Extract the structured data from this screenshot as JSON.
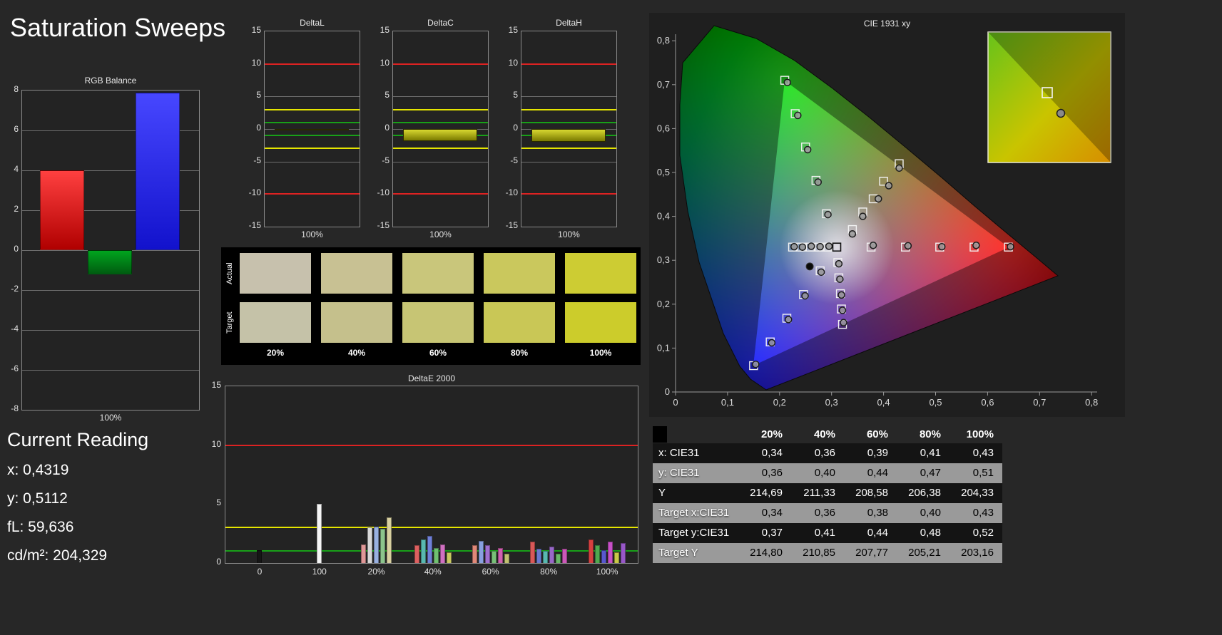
{
  "page": {
    "title": "Saturation Sweeps"
  },
  "colors": {
    "ref_red": "#dd2222",
    "ref_yellow": "#e6e600",
    "ref_green": "#18a018",
    "grid": "#6e6e6e"
  },
  "rgb_balance": {
    "title": "RGB Balance",
    "x_label": "100%",
    "type": "bar",
    "ylim": [
      -8,
      8
    ],
    "yticks": [
      8,
      6,
      4,
      2,
      0,
      -2,
      -4,
      -6,
      -8
    ],
    "bars": [
      {
        "name": "red",
        "value": 4.0,
        "color1": "#ff4040",
        "color2": "#b00000"
      },
      {
        "name": "green",
        "value": -1.2,
        "color1": "#00a41e",
        "color2": "#005c10"
      },
      {
        "name": "blue",
        "value": 7.9,
        "color1": "#4747ff",
        "color2": "#1212cc"
      }
    ]
  },
  "delta_charts": {
    "type": "bar",
    "ylim": [
      -15,
      15
    ],
    "yticks": [
      15,
      10,
      5,
      0,
      -5,
      -10,
      -15
    ],
    "gridlines": [
      5,
      0,
      -5
    ],
    "ref_lines": [
      {
        "v": 10,
        "color": "#dd2222"
      },
      {
        "v": 3,
        "color": "#e6e600"
      },
      {
        "v": 1,
        "color": "#18a018"
      },
      {
        "v": -1,
        "color": "#18a018"
      },
      {
        "v": -3,
        "color": "#e6e600"
      },
      {
        "v": -10,
        "color": "#dd2222"
      }
    ],
    "x_label": "100%",
    "bar_color1": "#d8d830",
    "bar_color2": "#7a7a00",
    "charts": [
      {
        "title": "DeltaL",
        "value": -0.2
      },
      {
        "title": "DeltaC",
        "value": -1.9
      },
      {
        "title": "DeltaH",
        "value": -2.0
      }
    ]
  },
  "swatches": {
    "row_labels": [
      "Actual",
      "Target"
    ],
    "percent_labels": [
      "20%",
      "40%",
      "60%",
      "80%",
      "100%"
    ],
    "actual": [
      "#c7c1ad",
      "#c8c193",
      "#c9c67b",
      "#cac85d",
      "#cdcc33"
    ],
    "target": [
      "#c5c2a8",
      "#c5c08c",
      "#c7c574",
      "#c9c756",
      "#cccc2b"
    ]
  },
  "deltae": {
    "title": "DeltaE 2000",
    "type": "bar",
    "ylim": [
      0,
      15
    ],
    "yticks": [
      0,
      5,
      10,
      15
    ],
    "ref_lines": [
      {
        "v": 10,
        "color": "#dd2222"
      },
      {
        "v": 3,
        "color": "#e6e600"
      },
      {
        "v": 1,
        "color": "#18a018"
      }
    ],
    "groups": [
      {
        "label": "0",
        "x": 0.083,
        "bars": [
          {
            "color": "#161616",
            "value": 1.1
          }
        ]
      },
      {
        "label": "100",
        "x": 0.228,
        "bars": [
          {
            "color": "#f5f5f5",
            "value": 5.0
          }
        ]
      },
      {
        "label": "20%",
        "x": 0.366,
        "bars": [
          {
            "color": "#e09898",
            "value": 1.6
          },
          {
            "color": "#d8d8d8",
            "value": 3.0
          },
          {
            "color": "#98b0e0",
            "value": 3.1
          },
          {
            "color": "#8cc48c",
            "value": 2.9
          },
          {
            "color": "#d8d0a0",
            "value": 3.9
          }
        ]
      },
      {
        "label": "40%",
        "x": 0.503,
        "bars": [
          {
            "color": "#dd6060",
            "value": 1.5
          },
          {
            "color": "#58b8b0",
            "value": 2.0
          },
          {
            "color": "#7080d8",
            "value": 2.3
          },
          {
            "color": "#70c070",
            "value": 1.3
          },
          {
            "color": "#d070c0",
            "value": 1.6
          },
          {
            "color": "#c8c860",
            "value": 0.9
          }
        ]
      },
      {
        "label": "60%",
        "x": 0.643,
        "bars": [
          {
            "color": "#e08878",
            "value": 1.5
          },
          {
            "color": "#88a0e0",
            "value": 1.9
          },
          {
            "color": "#a070d0",
            "value": 1.5
          },
          {
            "color": "#78c078",
            "value": 1.0
          },
          {
            "color": "#d060b0",
            "value": 1.3
          },
          {
            "color": "#c0c070",
            "value": 0.8
          }
        ]
      },
      {
        "label": "80%",
        "x": 0.784,
        "bars": [
          {
            "color": "#d85858",
            "value": 1.8
          },
          {
            "color": "#6878d0",
            "value": 1.2
          },
          {
            "color": "#58b8b0",
            "value": 1.0
          },
          {
            "color": "#9868c8",
            "value": 1.4
          },
          {
            "color": "#68b868",
            "value": 0.8
          },
          {
            "color": "#cc58b8",
            "value": 1.2
          }
        ]
      },
      {
        "label": "100%",
        "x": 0.926,
        "bars": [
          {
            "color": "#d84040",
            "value": 2.0
          },
          {
            "color": "#50a850",
            "value": 1.5
          },
          {
            "color": "#5858d0",
            "value": 1.1
          },
          {
            "color": "#c850c8",
            "value": 1.8
          },
          {
            "color": "#c8c848",
            "value": 0.9
          },
          {
            "color": "#9858c8",
            "value": 1.7
          }
        ]
      }
    ]
  },
  "cie": {
    "title": "CIE 1931 xy",
    "type": "scatter",
    "xlim": [
      0,
      0.8
    ],
    "ylim": [
      0,
      0.8
    ],
    "xticks": [
      "0",
      "0,1",
      "0,2",
      "0,3",
      "0,4",
      "0,5",
      "0,6",
      "0,7",
      "0,8"
    ],
    "yticks": [
      "0",
      "0,1",
      "0,2",
      "0,3",
      "0,4",
      "0,5",
      "0,6",
      "0,7",
      "0,8"
    ],
    "gamut_triangle": {
      "red": [
        0.64,
        0.33
      ],
      "green": [
        0.21,
        0.71
      ],
      "blue": [
        0.15,
        0.06
      ]
    },
    "white_point": [
      0.31,
      0.33
    ],
    "extra_dot": [
      0.258,
      0.286
    ],
    "sweeps": [
      {
        "name": "red",
        "targets": [
          [
            0.376,
            0.33
          ],
          [
            0.442,
            0.33
          ],
          [
            0.508,
            0.33
          ],
          [
            0.574,
            0.33
          ],
          [
            0.64,
            0.33
          ]
        ],
        "measured": [
          [
            0.38,
            0.334
          ],
          [
            0.447,
            0.333
          ],
          [
            0.512,
            0.331
          ],
          [
            0.578,
            0.334
          ],
          [
            0.644,
            0.331
          ]
        ]
      },
      {
        "name": "green",
        "targets": [
          [
            0.29,
            0.406
          ],
          [
            0.27,
            0.482
          ],
          [
            0.25,
            0.558
          ],
          [
            0.23,
            0.634
          ],
          [
            0.21,
            0.71
          ]
        ],
        "measured": [
          [
            0.293,
            0.404
          ],
          [
            0.274,
            0.478
          ],
          [
            0.254,
            0.552
          ],
          [
            0.235,
            0.63
          ],
          [
            0.215,
            0.705
          ]
        ]
      },
      {
        "name": "blue",
        "targets": [
          [
            0.278,
            0.276
          ],
          [
            0.246,
            0.222
          ],
          [
            0.214,
            0.168
          ],
          [
            0.182,
            0.114
          ],
          [
            0.15,
            0.06
          ]
        ],
        "measured": [
          [
            0.28,
            0.273
          ],
          [
            0.249,
            0.219
          ],
          [
            0.217,
            0.165
          ],
          [
            0.185,
            0.112
          ],
          [
            0.154,
            0.063
          ]
        ]
      },
      {
        "name": "cyan",
        "targets": [
          [
            0.293,
            0.33
          ],
          [
            0.276,
            0.33
          ],
          [
            0.259,
            0.33
          ],
          [
            0.242,
            0.33
          ],
          [
            0.225,
            0.33
          ]
        ],
        "measured": [
          [
            0.295,
            0.332
          ],
          [
            0.278,
            0.331
          ],
          [
            0.261,
            0.332
          ],
          [
            0.244,
            0.33
          ],
          [
            0.228,
            0.331
          ]
        ]
      },
      {
        "name": "magenta",
        "targets": [
          [
            0.312,
            0.295
          ],
          [
            0.314,
            0.26
          ],
          [
            0.317,
            0.224
          ],
          [
            0.319,
            0.189
          ],
          [
            0.321,
            0.154
          ]
        ],
        "measured": [
          [
            0.314,
            0.292
          ],
          [
            0.316,
            0.257
          ],
          [
            0.319,
            0.221
          ],
          [
            0.321,
            0.186
          ],
          [
            0.323,
            0.158
          ]
        ]
      },
      {
        "name": "yellow",
        "targets": [
          [
            0.34,
            0.37
          ],
          [
            0.36,
            0.41
          ],
          [
            0.38,
            0.44
          ],
          [
            0.4,
            0.48
          ],
          [
            0.43,
            0.52
          ]
        ],
        "measured": [
          [
            0.34,
            0.36
          ],
          [
            0.36,
            0.4
          ],
          [
            0.39,
            0.44
          ],
          [
            0.41,
            0.47
          ],
          [
            0.43,
            0.51
          ]
        ]
      }
    ]
  },
  "table": {
    "columns": [
      "20%",
      "40%",
      "60%",
      "80%",
      "100%"
    ],
    "rows": [
      {
        "label": "x: CIE31",
        "values": [
          "0,34",
          "0,36",
          "0,39",
          "0,41",
          "0,43"
        ]
      },
      {
        "label": "y: CIE31",
        "values": [
          "0,36",
          "0,40",
          "0,44",
          "0,47",
          "0,51"
        ]
      },
      {
        "label": "Y",
        "values": [
          "214,69",
          "211,33",
          "208,58",
          "206,38",
          "204,33"
        ]
      },
      {
        "label": "Target x:CIE31",
        "values": [
          "0,34",
          "0,36",
          "0,38",
          "0,40",
          "0,43"
        ]
      },
      {
        "label": "Target y:CIE31",
        "values": [
          "0,37",
          "0,41",
          "0,44",
          "0,48",
          "0,52"
        ]
      },
      {
        "label": "Target Y",
        "values": [
          "214,80",
          "210,85",
          "207,77",
          "205,21",
          "203,16"
        ]
      }
    ]
  },
  "current_reading": {
    "title": "Current Reading",
    "lines": [
      "x: 0,4319",
      "y: 0,5112",
      "fL: 59,636",
      "cd/m²: 204,329"
    ]
  }
}
